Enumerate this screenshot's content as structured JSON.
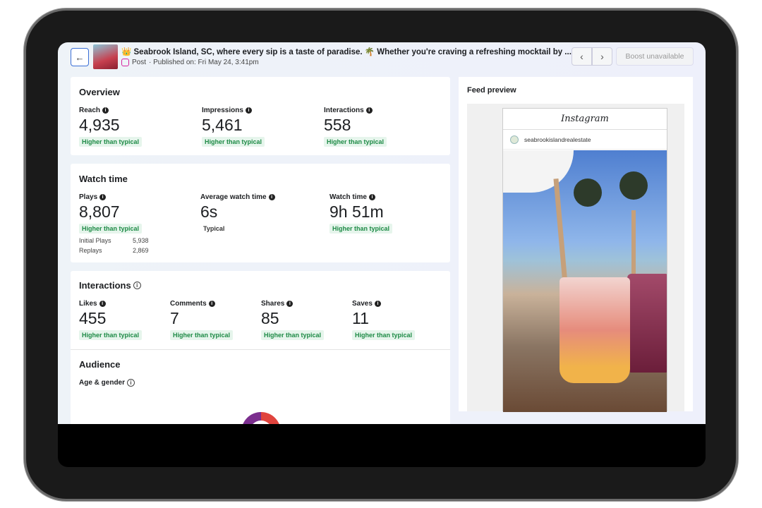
{
  "header": {
    "back_icon": "arrow-left-icon",
    "title": "👑 Seabrook Island, SC, where every sip is a taste of paradise. 🌴 Whether you're craving a refreshing mocktail by ...",
    "post_type": "Post",
    "published": "· Published on: Fri May 24, 3:41pm",
    "prev_icon": "chevron-left-icon",
    "next_icon": "chevron-right-icon",
    "boost_label": "Boost unavailable"
  },
  "overview": {
    "title": "Overview",
    "metrics": [
      {
        "label": "Reach",
        "value": "4,935",
        "status": "Higher than typical"
      },
      {
        "label": "Impressions",
        "value": "5,461",
        "status": "Higher than typical"
      },
      {
        "label": "Interactions",
        "value": "558",
        "status": "Higher than typical"
      }
    ]
  },
  "watch": {
    "title": "Watch time",
    "metrics": [
      {
        "label": "Plays",
        "value": "8,807",
        "status": "Higher than typical"
      },
      {
        "label": "Average watch time",
        "value": "6s",
        "status": "Typical"
      },
      {
        "label": "Watch time",
        "value": "9h 51m",
        "status": "Higher than typical"
      }
    ],
    "initial_label": "Initial Plays",
    "initial_value": "5,938",
    "replays_label": "Replays",
    "replays_value": "2,869"
  },
  "interactions": {
    "title": "Interactions",
    "metrics": [
      {
        "label": "Likes",
        "value": "455",
        "status": "Higher than typical"
      },
      {
        "label": "Comments",
        "value": "7",
        "status": "Higher than typical"
      },
      {
        "label": "Shares",
        "value": "85",
        "status": "Higher than typical"
      },
      {
        "label": "Saves",
        "value": "11",
        "status": "Higher than typical"
      }
    ]
  },
  "audience": {
    "title": "Audience",
    "subtitle": "Age & gender"
  },
  "feed": {
    "title": "Feed preview",
    "platform": "Instagram",
    "account": "seabrookislandrealestate"
  },
  "colors": {
    "accent": "#3b6fd6",
    "positive": "#1d8a45",
    "positive_bg": "#e6f5ec"
  }
}
